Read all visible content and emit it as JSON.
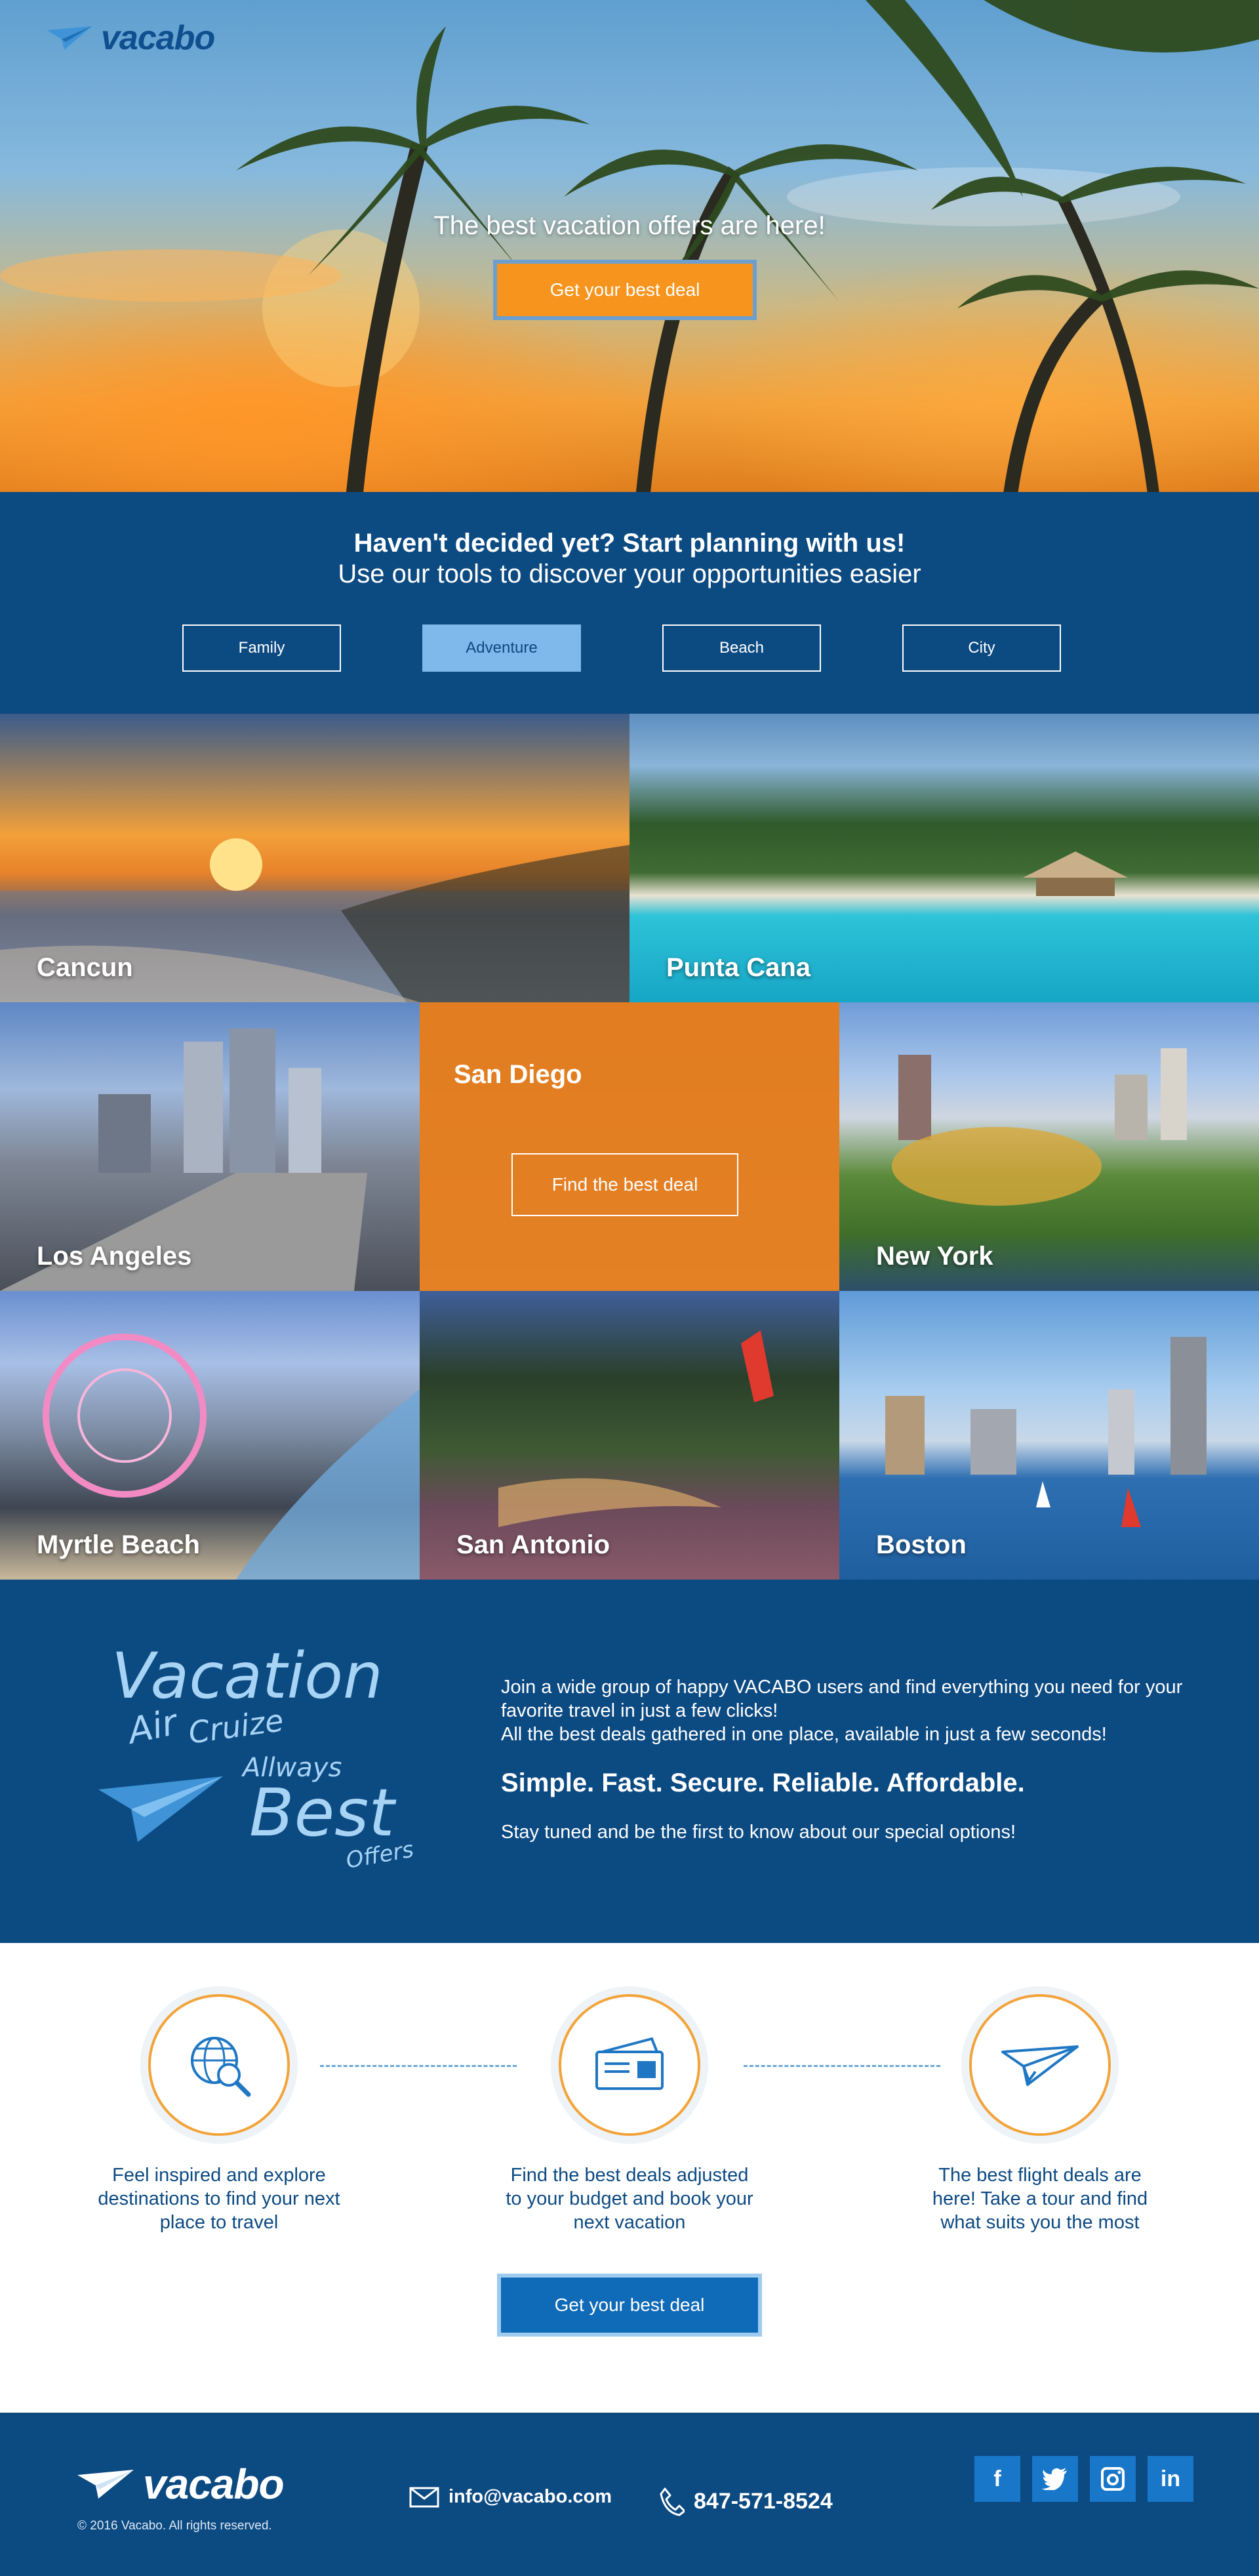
{
  "brand": {
    "name": "vacabo"
  },
  "hero": {
    "title": "The best vacation offers are here!",
    "cta_label": "Get your best deal"
  },
  "planning": {
    "heading": "Haven't decided yet? Start planning with us!",
    "subheading": "Use our tools to discover your opportunities easier",
    "filters": [
      {
        "label": "Family",
        "active": false
      },
      {
        "label": "Adventure",
        "active": true
      },
      {
        "label": "Beach",
        "active": false
      },
      {
        "label": "City",
        "active": false
      }
    ]
  },
  "destinations": [
    {
      "name": "Cancun"
    },
    {
      "name": "Punta Cana"
    },
    {
      "name": "Los Angeles"
    },
    {
      "name": "San Diego",
      "cta_label": "Find the best deal"
    },
    {
      "name": "New York"
    },
    {
      "name": "Myrtle Beach"
    },
    {
      "name": "San Antonio"
    },
    {
      "name": "Boston"
    }
  ],
  "about": {
    "word_art": [
      "Vacation",
      "Air",
      "Cruize",
      "Allways",
      "Best",
      "Offers"
    ],
    "line1": "Join a wide group of happy VACABO users and find everything you need for your favorite travel in just a few clicks!",
    "line2": "All the best deals gathered in one place, available in just a few seconds!",
    "tagline": "Simple. Fast. Secure. Reliable. Affordable.",
    "line3": "Stay tuned and be the first to know about our special options!"
  },
  "steps": [
    {
      "icon": "globe-search-icon",
      "text": "Feel inspired and explore destinations to find your next place to travel"
    },
    {
      "icon": "ticket-icon",
      "text": "Find the best deals adjusted to your budget and book your next vacation"
    },
    {
      "icon": "paper-plane-icon",
      "text": "The best flight deals are here! Take a tour and find what suits you the most"
    }
  ],
  "steps_cta_label": "Get your best deal",
  "footer": {
    "copyright": "© 2016 Vacabo. All rights reserved.",
    "email": "info@vacabo.com",
    "phone": "847-571-8524",
    "socials": [
      "f",
      "t",
      "ig",
      "in"
    ]
  },
  "colors": {
    "navy": "#0c4a82",
    "orange": "#f7941d",
    "light_blue": "#7fb8ea",
    "button_blue": "#0f6ab7"
  }
}
